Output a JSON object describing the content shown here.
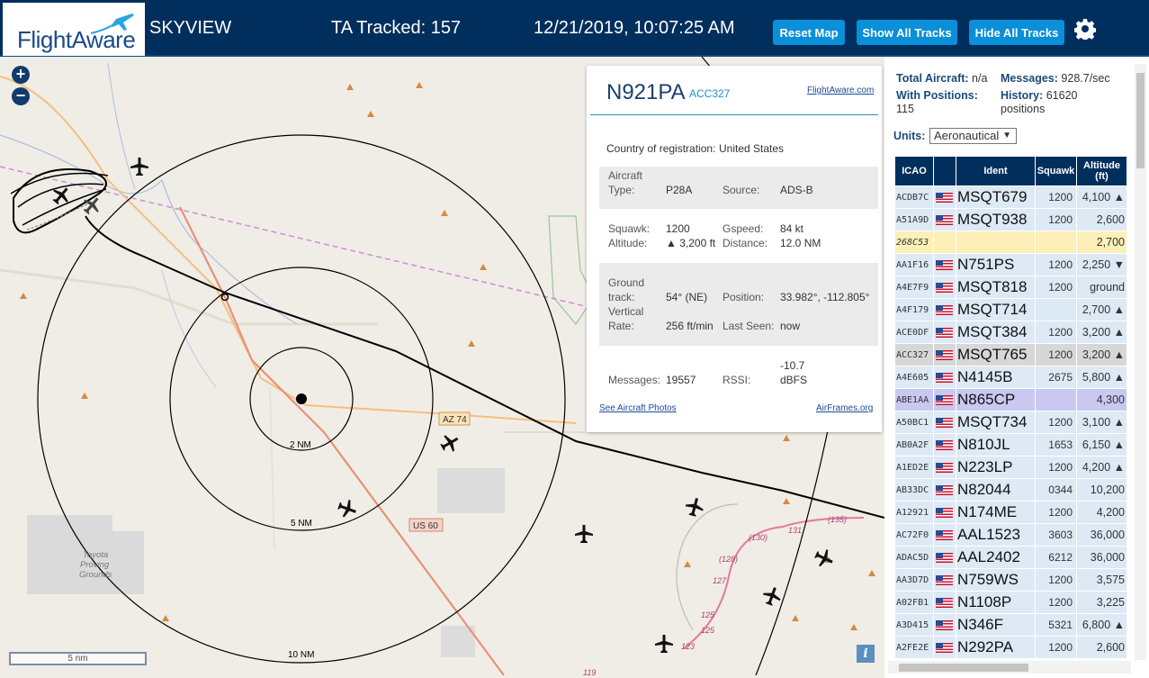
{
  "header": {
    "logo_text": "FlightAware",
    "app_name": "SKYVIEW",
    "ta_tracked": "TA Tracked: 157",
    "datetime": "12/21/2019, 10:07:25 AM",
    "buttons": {
      "reset_map": "Reset Map",
      "show_all": "Show All Tracks",
      "hide_all": "Hide All Tracks"
    },
    "settings_icon": "gear-icon"
  },
  "map": {
    "zoom_in": "+",
    "zoom_out": "−",
    "range_labels": {
      "r2": "2 NM",
      "r5": "5 NM",
      "r10": "10 NM"
    },
    "road_labels": {
      "az74": "AZ 74",
      "us60": "US 60"
    },
    "place_label_1": "Toyota",
    "place_label_2": "Proving",
    "place_label_3": "Grounds",
    "route_numbers": [
      "131",
      "(135)",
      "(130)",
      "(128)",
      "127",
      "125",
      "125",
      "123",
      "119"
    ],
    "scale_label": "5 nm",
    "info_button": "i"
  },
  "popup": {
    "registration": "N921PA",
    "icao": "ACC327",
    "fa_link": "FlightAware.com",
    "country_label": "Country of registration:",
    "country": "United States",
    "aircraft_type_label_1": "Aircraft",
    "aircraft_type_label_2": "Type:",
    "aircraft_type": "P28A",
    "source_label": "Source:",
    "source": "ADS-B",
    "squawk_label": "Squawk:",
    "squawk": "1200",
    "gspeed_label": "Gspeed:",
    "gspeed": "84 kt",
    "altitude_label": "Altitude:",
    "altitude": "▲ 3,200 ft",
    "distance_label": "Distance:",
    "distance": "12.0 NM",
    "ground_track_label_1": "Ground",
    "ground_track_label_2": "track:",
    "ground_track": "54° (NE)",
    "position_label": "Position:",
    "position": "33.982°, -112.805°",
    "vrate_label_1": "Vertical",
    "vrate_label_2": "Rate:",
    "vrate": "256 ft/min",
    "last_seen_label": "Last Seen:",
    "last_seen": "now",
    "messages_label": "Messages:",
    "messages": "19557",
    "rssi_label": "RSSI:",
    "rssi_1": "-10.7",
    "rssi_2": "dBFS",
    "photos_link": "See Aircraft Photos",
    "airframes_link": "AirFrames.org"
  },
  "panel": {
    "total_label": "Total Aircraft:",
    "total": "n/a",
    "messages_label": "Messages:",
    "messages": "928.7/sec",
    "with_pos_label": "With Positions:",
    "with_pos": "115",
    "history_label": "History:",
    "history_1": "61620",
    "history_2": "positions",
    "units_label": "Units:",
    "units_value": "Aeronautical",
    "columns": [
      "ICAO",
      "",
      "Ident",
      "Squawk",
      "Altitude (ft)"
    ],
    "rows": [
      {
        "icao": "ACDB7C",
        "flag": true,
        "ident": "MSQT679",
        "squawk": "1200",
        "alt": "4,100 ▲",
        "state": ""
      },
      {
        "icao": "A51A9D",
        "flag": true,
        "ident": "MSQT938",
        "squawk": "1200",
        "alt": "2,600",
        "state": ""
      },
      {
        "icao": "268C53",
        "flag": false,
        "ident": "",
        "squawk": "",
        "alt": "2,700",
        "state": "hl"
      },
      {
        "icao": "AA1F16",
        "flag": true,
        "ident": "N751PS",
        "squawk": "1200",
        "alt": "2,250 ▼",
        "state": ""
      },
      {
        "icao": "A4E7F9",
        "flag": true,
        "ident": "MSQT818",
        "squawk": "1200",
        "alt": "ground",
        "state": ""
      },
      {
        "icao": "A4F179",
        "flag": true,
        "ident": "MSQT714",
        "squawk": "",
        "alt": "2,700 ▲",
        "state": ""
      },
      {
        "icao": "ACE0DF",
        "flag": true,
        "ident": "MSQT384",
        "squawk": "1200",
        "alt": "3,200 ▲",
        "state": ""
      },
      {
        "icao": "ACC327",
        "flag": true,
        "ident": "MSQT765",
        "squawk": "1200",
        "alt": "3,200 ▲",
        "state": "sel"
      },
      {
        "icao": "A4E605",
        "flag": true,
        "ident": "N4145B",
        "squawk": "2675",
        "alt": "5,800 ▲",
        "state": ""
      },
      {
        "icao": "ABE1AA",
        "flag": true,
        "ident": "N865CP",
        "squawk": "",
        "alt": "4,300",
        "state": "sel2"
      },
      {
        "icao": "A50BC1",
        "flag": true,
        "ident": "MSQT734",
        "squawk": "1200",
        "alt": "3,100 ▲",
        "state": ""
      },
      {
        "icao": "AB0A2F",
        "flag": true,
        "ident": "N810JL",
        "squawk": "1653",
        "alt": "6,150 ▲",
        "state": ""
      },
      {
        "icao": "A1ED2E",
        "flag": true,
        "ident": "N223LP",
        "squawk": "1200",
        "alt": "4,200 ▲",
        "state": ""
      },
      {
        "icao": "AB33DC",
        "flag": true,
        "ident": "N82044",
        "squawk": "0344",
        "alt": "10,200",
        "state": ""
      },
      {
        "icao": "A12921",
        "flag": true,
        "ident": "N174ME",
        "squawk": "1200",
        "alt": "4,200",
        "state": ""
      },
      {
        "icao": "AC72F0",
        "flag": true,
        "ident": "AAL1523",
        "squawk": "3603",
        "alt": "36,000",
        "state": ""
      },
      {
        "icao": "ADAC5D",
        "flag": true,
        "ident": "AAL2402",
        "squawk": "6212",
        "alt": "36,000",
        "state": ""
      },
      {
        "icao": "AA3D7D",
        "flag": true,
        "ident": "N759WS",
        "squawk": "1200",
        "alt": "3,575",
        "state": ""
      },
      {
        "icao": "A02FB1",
        "flag": true,
        "ident": "N1108P",
        "squawk": "1200",
        "alt": "3,225",
        "state": ""
      },
      {
        "icao": "A3D415",
        "flag": true,
        "ident": "N346F",
        "squawk": "5321",
        "alt": "6,800 ▲",
        "state": ""
      },
      {
        "icao": "A2FE2E",
        "flag": true,
        "ident": "N292PA",
        "squawk": "1200",
        "alt": "2,600",
        "state": ""
      }
    ]
  }
}
